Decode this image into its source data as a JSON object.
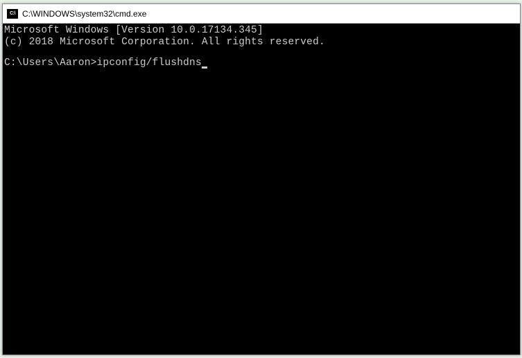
{
  "titlebar": {
    "icon_label": "C:\\",
    "title": "C:\\WINDOWS\\system32\\cmd.exe"
  },
  "terminal": {
    "line1": "Microsoft Windows [Version 10.0.17134.345]",
    "line2": "(c) 2018 Microsoft Corporation. All rights reserved.",
    "prompt": "C:\\Users\\Aaron>",
    "command": "ipconfig/flushdns"
  }
}
